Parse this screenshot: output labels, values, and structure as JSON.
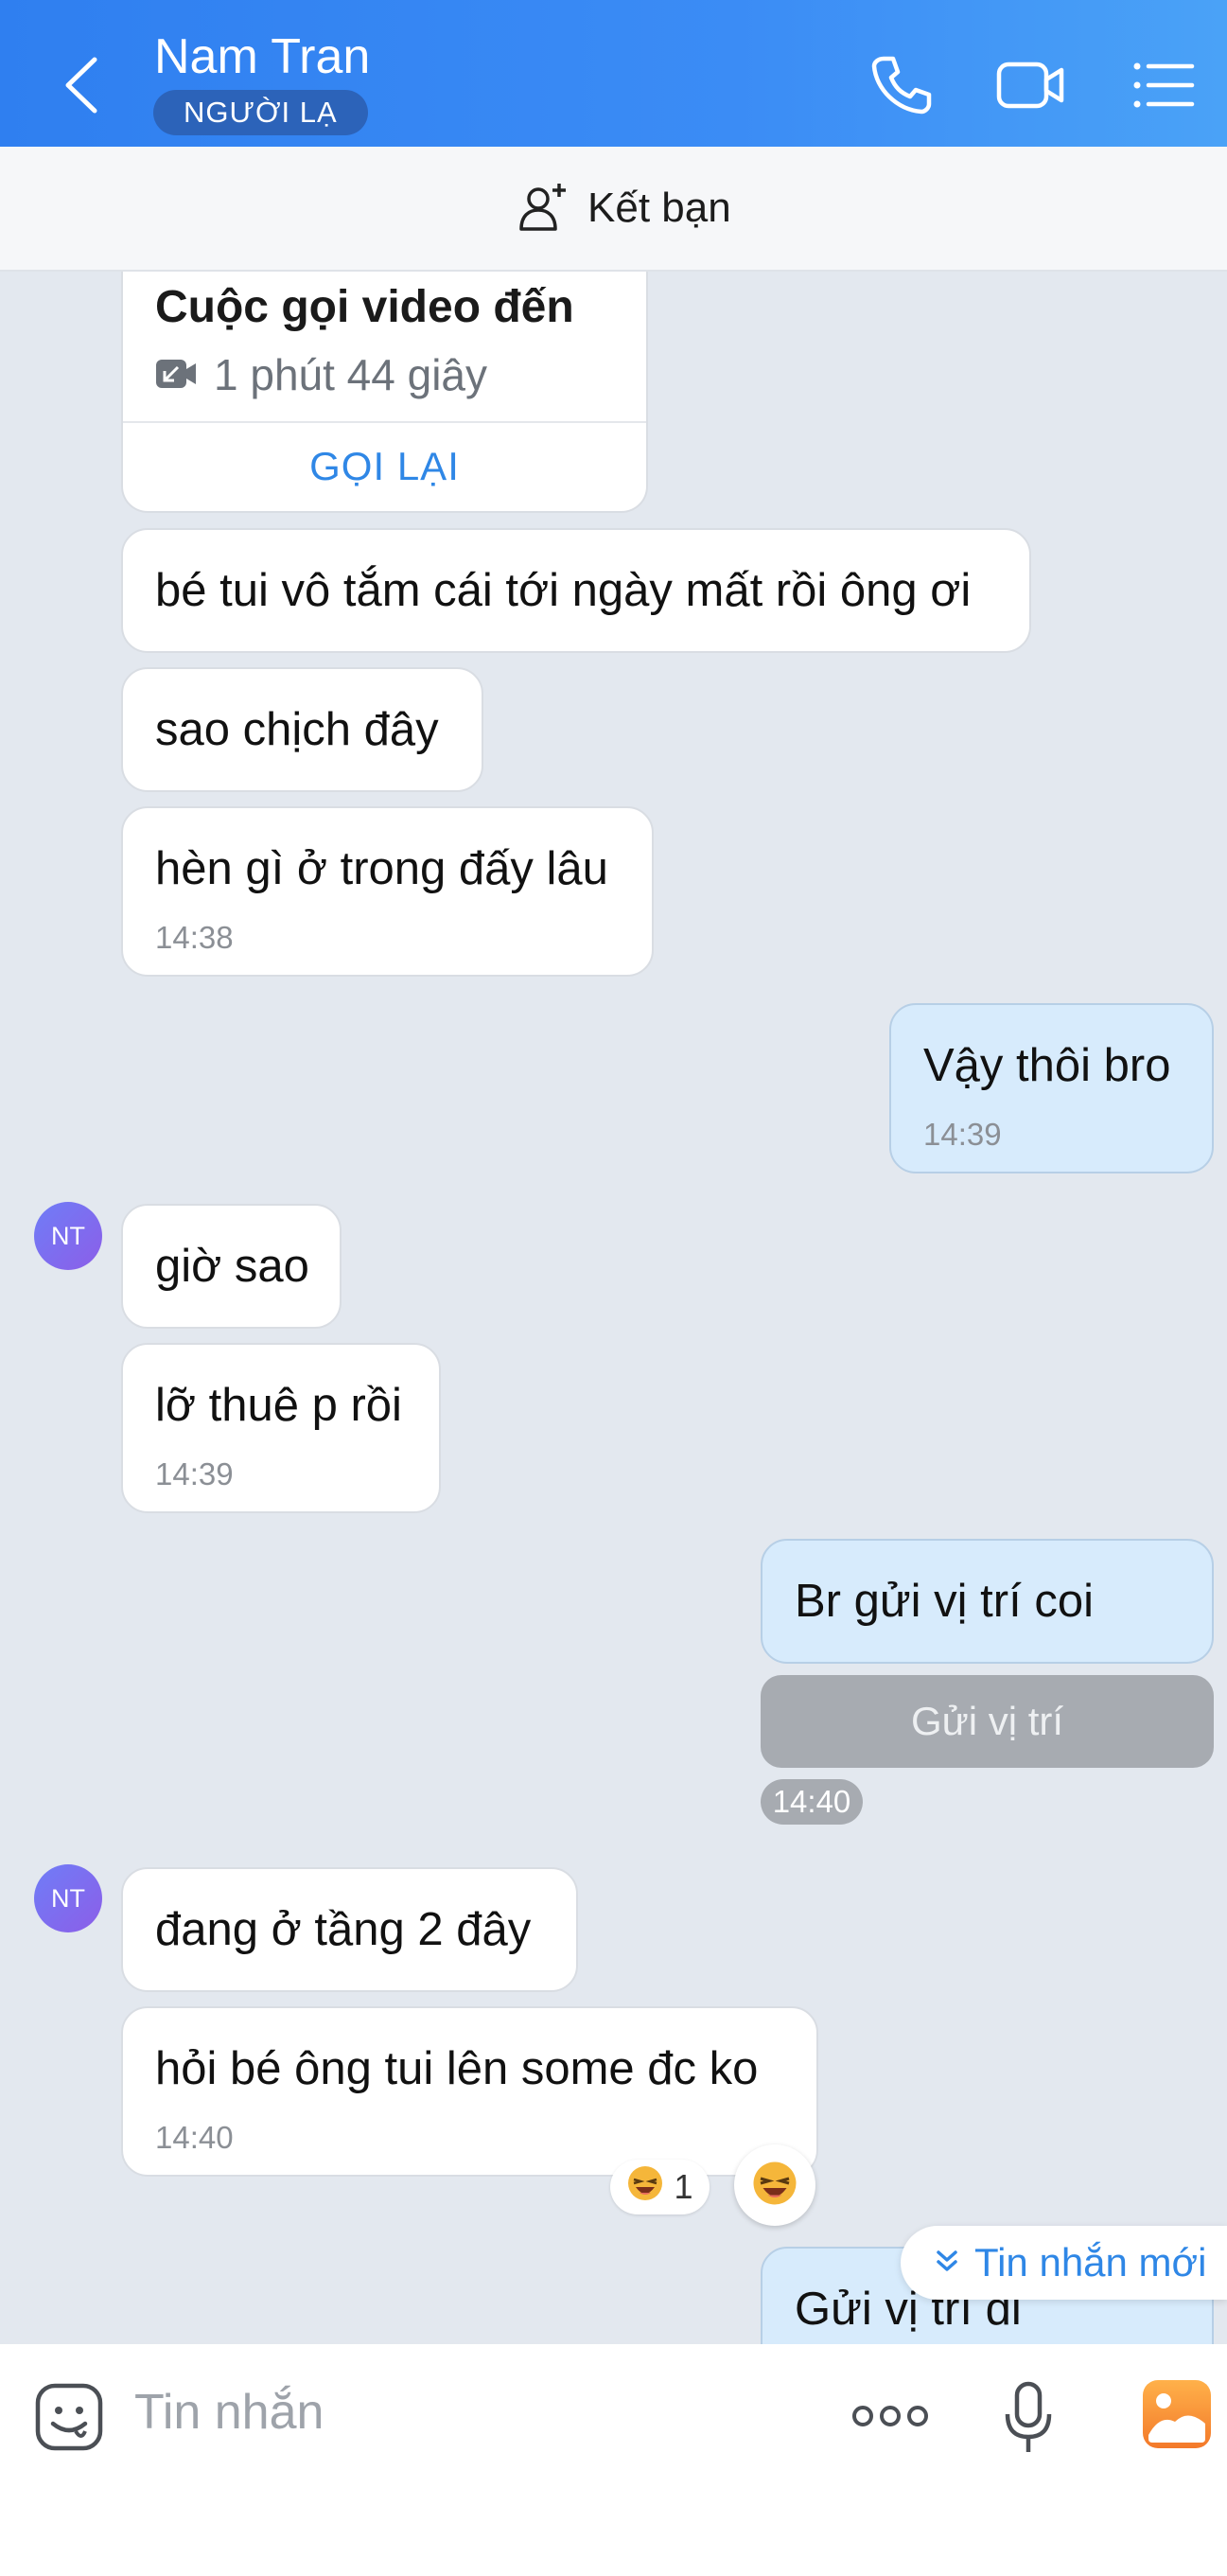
{
  "header": {
    "title": "Nam Tran",
    "badge": "NGƯỜI LẠ",
    "icons": [
      "back-arrow-icon",
      "phone-icon",
      "video-camera-icon",
      "list-menu-icon"
    ]
  },
  "friend_bar": {
    "label": "Kết bạn",
    "icon": "add-user-icon"
  },
  "call_card": {
    "title": "Cuộc gọi video đến",
    "duration": "1 phút 44 giây",
    "action": "GỌI LẠI"
  },
  "messages": [
    {
      "dir": "in",
      "text": "bé tui vô tắm cái tới ngày mất rồi ông ơi"
    },
    {
      "dir": "in",
      "text": "sao chịch đây"
    },
    {
      "dir": "in",
      "text": "hèn gì ở trong đấy lâu",
      "time": "14:38"
    },
    {
      "dir": "out",
      "text": "Vậy thôi bro",
      "time": "14:39"
    },
    {
      "dir": "in",
      "avatar": "NT",
      "text": "giờ sao"
    },
    {
      "dir": "in",
      "text": "lỡ thuê p rồi",
      "time": "14:39"
    },
    {
      "dir": "out",
      "text": "Br gửi vị trí coi"
    },
    {
      "dir": "out",
      "text": "Gửi vị trí",
      "kind": "location-button",
      "time": "14:40"
    },
    {
      "dir": "in",
      "avatar": "NT",
      "text": "đang ở tầng 2 đây"
    },
    {
      "dir": "in",
      "text": "hỏi bé ông tui lên some đc ko",
      "time": "14:40"
    },
    {
      "dir": "out",
      "text": "Gửi vị trí đi"
    }
  ],
  "reaction": {
    "emoji": "laughing-face",
    "count": "1"
  },
  "new_messages_label": "Tin nhắn mới",
  "input": {
    "placeholder": "Tin nhắn"
  },
  "colors": {
    "header": "#3b8cf5",
    "accent": "#2f87e6",
    "outgoing": "#d7ebfc",
    "background": "#e3e8ef"
  }
}
